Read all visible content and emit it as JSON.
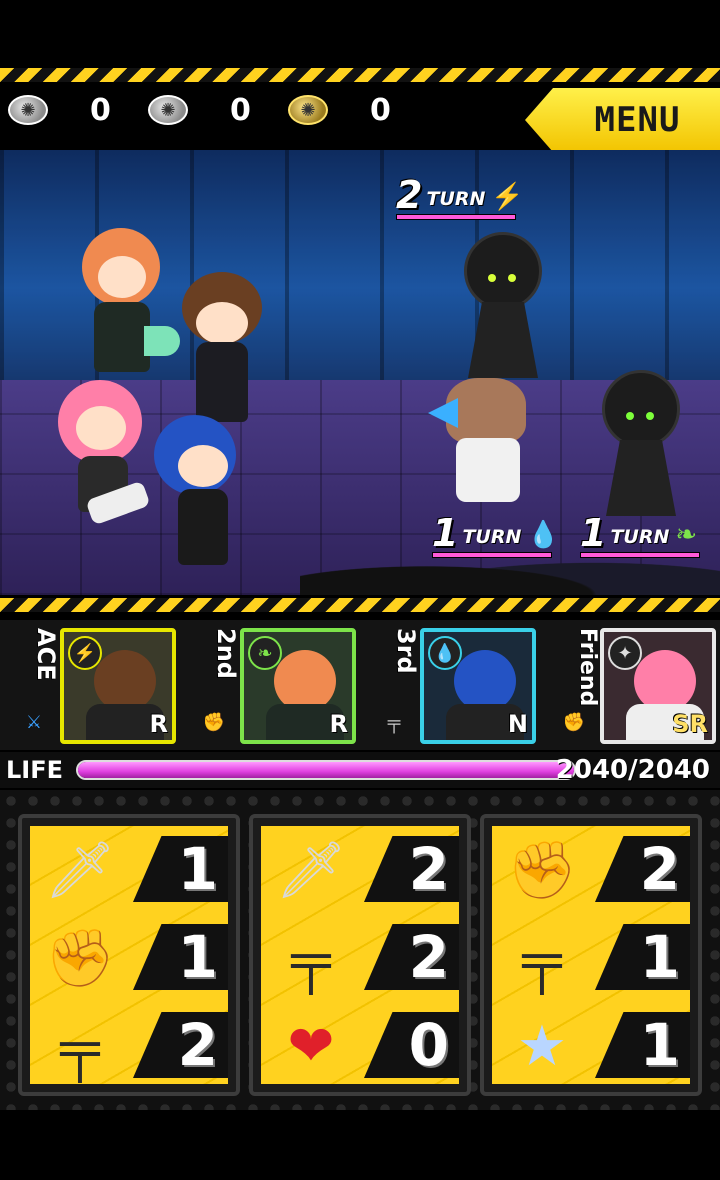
{
  "hud": {
    "counters": [
      {
        "icon": "silver-bomb-icon",
        "value": "0"
      },
      {
        "icon": "silver-bomb-icon",
        "value": "0"
      },
      {
        "icon": "gold-bomb-icon",
        "value": "0"
      }
    ],
    "menu_label": "MENU"
  },
  "enemies": [
    {
      "turns": "2",
      "turn_label": "TURN",
      "element": "lightning",
      "hp_fraction": 1.0
    },
    {
      "turns": "1",
      "turn_label": "TURN",
      "element": "water",
      "hp_fraction": 1.0
    },
    {
      "turns": "1",
      "turn_label": "TURN",
      "element": "wind",
      "hp_fraction": 1.0
    }
  ],
  "party": [
    {
      "rank": "ACE",
      "element": "lightning",
      "rarity": "R",
      "weapon": "sword",
      "color": "#e6e600"
    },
    {
      "rank": "2nd",
      "element": "wind",
      "rarity": "R",
      "weapon": "fist",
      "color": "#7de34a"
    },
    {
      "rank": "3rd",
      "element": "water",
      "rarity": "N",
      "weapon": "gun",
      "color": "#3ad0e8"
    },
    {
      "rank": "Friend",
      "element": "star",
      "rarity": "SR",
      "weapon": "fist",
      "color": "#e8e8e8"
    }
  ],
  "life": {
    "label": "LIFE",
    "value": "2040/2040",
    "fraction": 1.0
  },
  "reels": [
    [
      {
        "symbol": "knife",
        "count": "1"
      },
      {
        "symbol": "fist",
        "count": "1"
      },
      {
        "symbol": "gun",
        "count": "2"
      }
    ],
    [
      {
        "symbol": "knife",
        "count": "2"
      },
      {
        "symbol": "gun",
        "count": "2"
      },
      {
        "symbol": "heart",
        "count": "0"
      }
    ],
    [
      {
        "symbol": "fist",
        "count": "2"
      },
      {
        "symbol": "gun",
        "count": "1"
      },
      {
        "symbol": "star",
        "count": "1"
      }
    ]
  ]
}
